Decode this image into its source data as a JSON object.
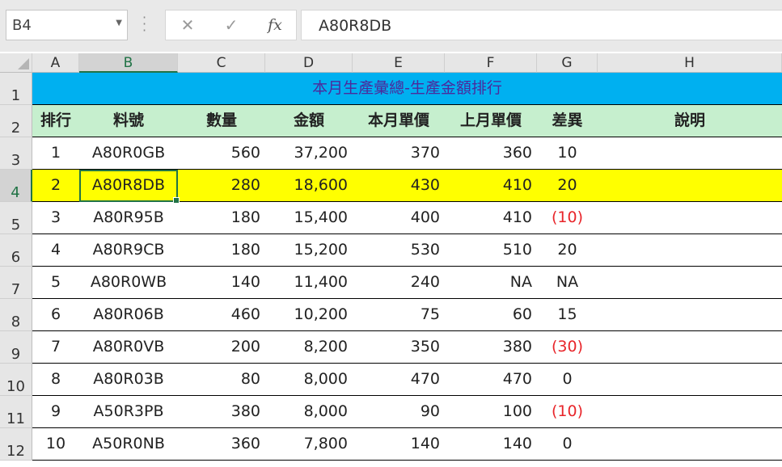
{
  "name_box": "B4",
  "formula_bar": {
    "cancel_icon": "✕",
    "enter_icon": "✓",
    "fx_label": "fx",
    "formula": "A80R8DB"
  },
  "columns": [
    "A",
    "B",
    "C",
    "D",
    "E",
    "F",
    "G",
    "H"
  ],
  "selected_column": "B",
  "row_numbers": [
    "1",
    "2",
    "3",
    "4",
    "5",
    "6",
    "7",
    "8",
    "9",
    "10",
    "11",
    "12"
  ],
  "selected_row": "4",
  "sheet": {
    "title": "本月生產彙總-生產金額排行",
    "headers": [
      "排行",
      "料號",
      "數量",
      "金額",
      "本月單價",
      "上月單價",
      "差異",
      "說明"
    ],
    "rows": [
      [
        "1",
        "A80R0GB",
        "560",
        "37,200",
        "370",
        "360",
        "10",
        ""
      ],
      [
        "2",
        "A80R8DB",
        "280",
        "18,600",
        "430",
        "410",
        "20",
        ""
      ],
      [
        "3",
        "A80R95B",
        "180",
        "15,400",
        "400",
        "410",
        "(10)",
        ""
      ],
      [
        "4",
        "A80R9CB",
        "180",
        "15,200",
        "530",
        "510",
        "20",
        ""
      ],
      [
        "5",
        "A80R0WB",
        "140",
        "11,400",
        "240",
        "NA",
        "NA",
        ""
      ],
      [
        "6",
        "A80R06B",
        "460",
        "10,200",
        "75",
        "60",
        "15",
        ""
      ],
      [
        "7",
        "A80R0VB",
        "200",
        "8,200",
        "350",
        "380",
        "(30)",
        ""
      ],
      [
        "8",
        "A80R03B",
        "80",
        "8,000",
        "470",
        "470",
        "0",
        ""
      ],
      [
        "9",
        "A50R3PB",
        "380",
        "8,000",
        "90",
        "100",
        "(10)",
        ""
      ],
      [
        "10",
        "A50R0NB",
        "360",
        "7,800",
        "140",
        "140",
        "0",
        ""
      ]
    ]
  },
  "colors": {
    "title_fill": "#00b0f0",
    "header_fill": "#c6efce",
    "highlight_fill": "#ffff00",
    "negative_text": "#e8252a",
    "selection": "#217346"
  }
}
